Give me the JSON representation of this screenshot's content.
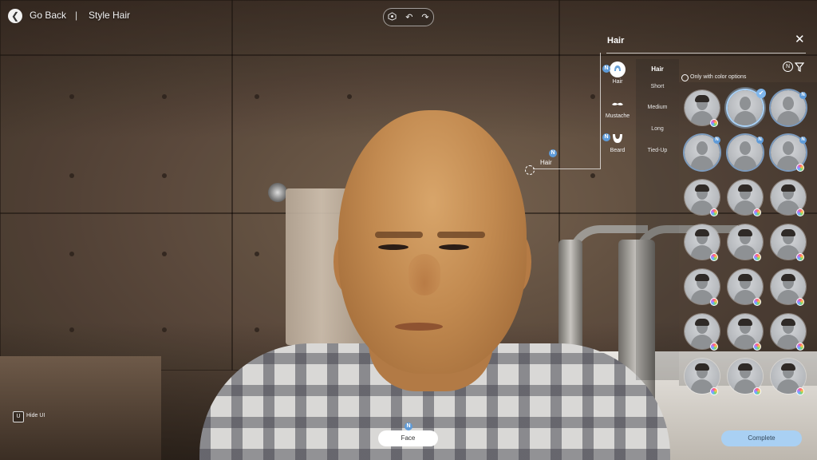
{
  "top_bar": {
    "back_label": "Go Back",
    "separator": "|",
    "screen_title": "Style Hair",
    "controls": [
      "reset-icon",
      "undo-icon",
      "redo-icon"
    ]
  },
  "panel": {
    "title": "Hair",
    "close_icon": "close-icon",
    "categories": [
      {
        "label": "Hair",
        "icon": "hair-icon",
        "active": true,
        "new": true
      },
      {
        "label": "Mustache",
        "icon": "mustache-icon",
        "active": false,
        "new": false
      },
      {
        "label": "Beard",
        "icon": "beard-icon",
        "active": false,
        "new": true
      }
    ],
    "subcategories": [
      {
        "label": "Hair",
        "active": true
      },
      {
        "label": "Short",
        "active": false
      },
      {
        "label": "Medium",
        "active": false
      },
      {
        "label": "Long",
        "active": false
      },
      {
        "label": "Tied-Up",
        "active": false
      }
    ],
    "color_filter_label": "Only with color options",
    "new_badge": "N",
    "filter_icon": "filter-icon"
  },
  "hairstyles": {
    "selected_index": 1,
    "items": [
      {
        "hair": true,
        "new": false,
        "color": true
      },
      {
        "hair": false,
        "new": false,
        "color": false,
        "selected": true
      },
      {
        "hair": false,
        "new": true,
        "color": false
      },
      {
        "hair": false,
        "new": true,
        "color": false
      },
      {
        "hair": false,
        "new": true,
        "color": false
      },
      {
        "hair": false,
        "new": true,
        "color": true
      },
      {
        "hair": true,
        "new": false,
        "color": true
      },
      {
        "hair": true,
        "new": false,
        "color": true
      },
      {
        "hair": true,
        "new": false,
        "color": true
      },
      {
        "hair": true,
        "new": false,
        "color": true
      },
      {
        "hair": true,
        "new": false,
        "color": true
      },
      {
        "hair": true,
        "new": false,
        "color": true
      },
      {
        "hair": true,
        "new": false,
        "color": true
      },
      {
        "hair": true,
        "new": false,
        "color": true
      },
      {
        "hair": true,
        "new": false,
        "color": true
      },
      {
        "hair": true,
        "new": false,
        "color": true
      },
      {
        "hair": true,
        "new": false,
        "color": true
      },
      {
        "hair": true,
        "new": false,
        "color": true
      },
      {
        "hair": true,
        "new": false,
        "color": true
      },
      {
        "hair": true,
        "new": false,
        "color": true
      },
      {
        "hair": true,
        "new": false,
        "color": true
      }
    ]
  },
  "scene": {
    "hair_point_label": "Hair",
    "new_badge": "N"
  },
  "bottom": {
    "hide_key": "U",
    "hide_label": "Hide UI",
    "face_label": "Face",
    "face_badge": "N",
    "complete_label": "Complete"
  },
  "colors": {
    "accent": "#a9d0f3",
    "badge": "#5f9bd8"
  }
}
